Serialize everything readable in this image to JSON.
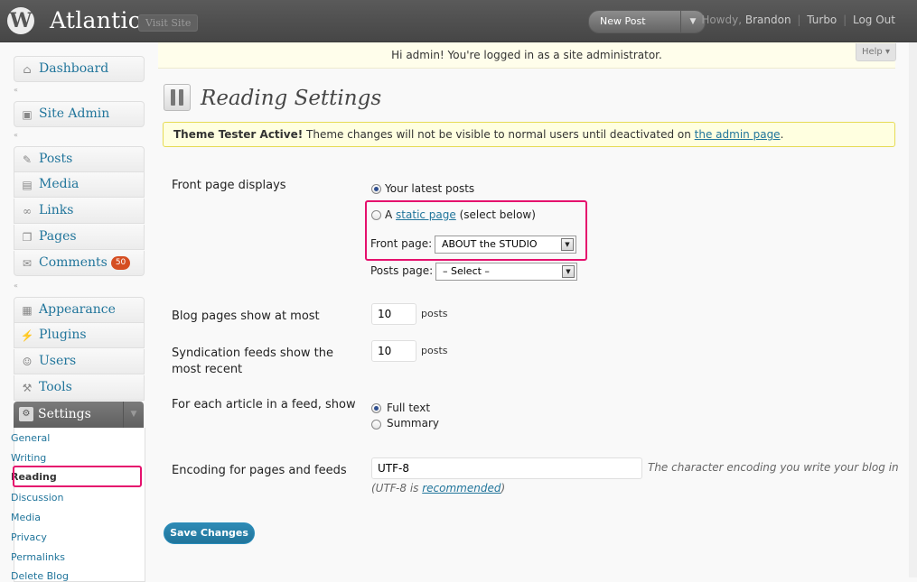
{
  "header": {
    "site_title": "Atlantica",
    "visit_site": "Visit Site",
    "new_post": "New Post",
    "howdy_prefix": "Howdy,",
    "user_name": "Brandon",
    "turbo": "Turbo",
    "logout": "Log Out",
    "sep": "|"
  },
  "admin_notice": "Hi admin! You're logged in as a site administrator.",
  "help": "Help",
  "sidebar": {
    "items": [
      {
        "label": "Dashboard",
        "icon": "home-icon"
      },
      {
        "label": "Site Admin",
        "icon": "site-admin-icon"
      },
      {
        "label": "Posts",
        "icon": "pin-icon"
      },
      {
        "label": "Media",
        "icon": "media-icon"
      },
      {
        "label": "Links",
        "icon": "link-icon"
      },
      {
        "label": "Pages",
        "icon": "pages-icon"
      },
      {
        "label": "Comments",
        "icon": "comment-icon",
        "badge": "50"
      },
      {
        "label": "Appearance",
        "icon": "appearance-icon"
      },
      {
        "label": "Plugins",
        "icon": "plugin-icon"
      },
      {
        "label": "Users",
        "icon": "users-icon"
      },
      {
        "label": "Tools",
        "icon": "tools-icon"
      }
    ],
    "settings": {
      "label": "Settings",
      "submenu": [
        "General",
        "Writing",
        "Reading",
        "Discussion",
        "Media",
        "Privacy",
        "Permalinks",
        "Delete Blog"
      ],
      "current": "Reading"
    }
  },
  "page": {
    "title": "Reading Settings",
    "theme_notice": {
      "bold": "Theme Tester Active!",
      "text": "Theme changes will not be visible to normal users until deactivated on",
      "link": "the admin page",
      "end": "."
    },
    "front_page": {
      "label": "Front page displays",
      "latest": "Your latest posts",
      "static_prefix": "A",
      "static_link": "static page",
      "static_suffix": "(select below)",
      "front_label": "Front page:",
      "front_value": "ABOUT the STUDIO",
      "posts_label": "Posts page:",
      "posts_value": "– Select –",
      "selected": "latest"
    },
    "blog_pages": {
      "label": "Blog pages show at most",
      "value": "10",
      "unit": "posts"
    },
    "syndication": {
      "label_line1": "Syndication feeds show the",
      "label_line2": "most recent",
      "value": "10",
      "unit": "posts"
    },
    "feed_article": {
      "label": "For each article in a feed, show",
      "full": "Full text",
      "summary": "Summary",
      "selected": "full"
    },
    "encoding": {
      "label": "Encoding for pages and feeds",
      "value": "UTF-8",
      "desc": "The character encoding you write your blog in",
      "desc2_prefix": "(UTF-8 is",
      "desc2_link": "recommended",
      "desc2_suffix": ")"
    },
    "save": "Save Changes"
  },
  "colors": {
    "link": "#21759b",
    "highlight": "#e5116d",
    "badge": "#d54e21"
  }
}
